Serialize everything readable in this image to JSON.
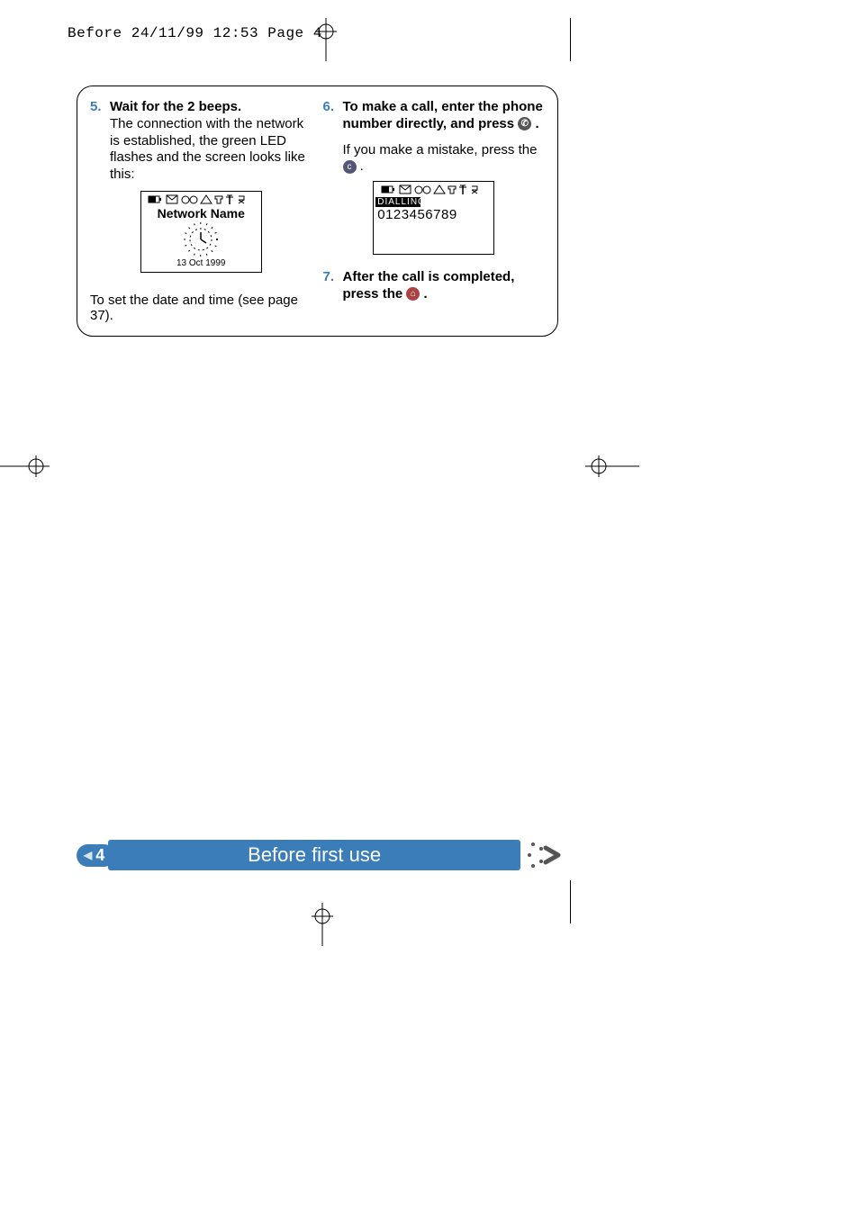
{
  "header": {
    "slug": "Before  24/11/99 12:53  Page 4"
  },
  "steps": {
    "five": {
      "num": "5.",
      "title": "Wait for the 2 beeps.",
      "body": "The connection with the network is established, the green LED flashes and the screen looks like this:",
      "footnote": "To set the date and time (see page 37)."
    },
    "six": {
      "num": "6.",
      "title_1": "To make a call, enter the phone number directly, and press",
      "title_2": ".",
      "body_1": "If you make a mistake, press the",
      "body_2": "."
    },
    "seven": {
      "num": "7.",
      "title_1": "After the call is completed, press the",
      "title_2": "."
    }
  },
  "screen1": {
    "network": "Network Name",
    "date": "13 Oct 1999"
  },
  "screen2": {
    "label": "DIALLING",
    "number": "0123456789"
  },
  "footer": {
    "page": "4",
    "title": "Before first use"
  },
  "icons": {
    "call": "✆",
    "clear": "c",
    "hangup": "⌂"
  }
}
